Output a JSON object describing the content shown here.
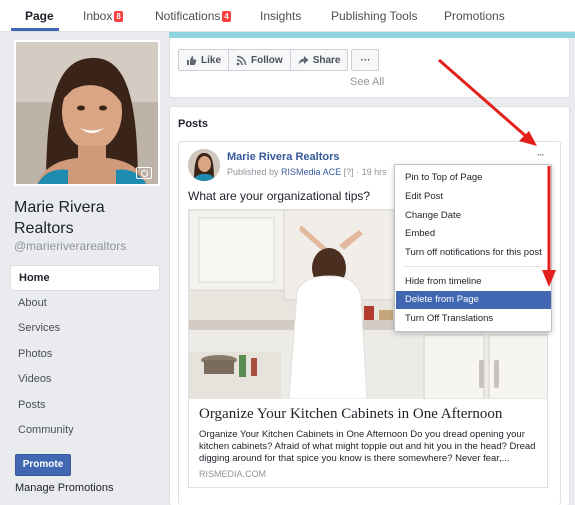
{
  "tabs": [
    {
      "label": "Page",
      "active": true
    },
    {
      "label": "Inbox",
      "badge": "8"
    },
    {
      "label": "Notifications",
      "badge": "4"
    },
    {
      "label": "Insights"
    },
    {
      "label": "Publishing Tools"
    },
    {
      "label": "Promotions"
    }
  ],
  "profile": {
    "name": "Marie Rivera Realtors",
    "handle": "@marieriverarealtors"
  },
  "sidebar": {
    "items": [
      {
        "label": "Home",
        "active": true
      },
      {
        "label": "About"
      },
      {
        "label": "Services"
      },
      {
        "label": "Photos"
      },
      {
        "label": "Videos"
      },
      {
        "label": "Posts"
      },
      {
        "label": "Community"
      }
    ],
    "promote_label": "Promote",
    "manage_promotions_label": "Manage Promotions"
  },
  "page_actions": {
    "like_label": "Like",
    "follow_label": "Follow",
    "share_label": "Share",
    "more_label": "···",
    "see_all_label": "See All"
  },
  "posts": {
    "section_title": "Posts",
    "post": {
      "author": "Marie Rivera Realtors",
      "published_by_prefix": "Published by ",
      "publisher": "RISMedia ACE",
      "publisher_suffix": " [?] · 19 hrs",
      "more_label": "···",
      "text": "What are your organizational tips?",
      "link": {
        "title": "Organize Your Kitchen Cabinets in One Afternoon",
        "description": "Organize Your Kitchen Cabinets in One Afternoon Do you dread opening your kitchen cabinets? Afraid of what might topple out and hit you in the head? Dread digging around for that spice you know is there somewhere? Never fear,...",
        "domain": "RISMEDIA.COM"
      }
    }
  },
  "dropdown": {
    "items": [
      {
        "label": "Pin to Top of Page"
      },
      {
        "label": "Edit Post"
      },
      {
        "label": "Change Date"
      },
      {
        "label": "Embed"
      },
      {
        "label": "Turn off notifications for this post"
      },
      {
        "label": "Hide from timeline"
      },
      {
        "label": "Delete from Page",
        "highlighted": true
      },
      {
        "label": "Turn Off Translations"
      }
    ]
  },
  "colors": {
    "brand_blue": "#4267b2",
    "link_blue": "#365899",
    "badge_red": "#fa3e3e",
    "arrow_red": "#e3211c",
    "teal_bar": "#8dd4de"
  }
}
